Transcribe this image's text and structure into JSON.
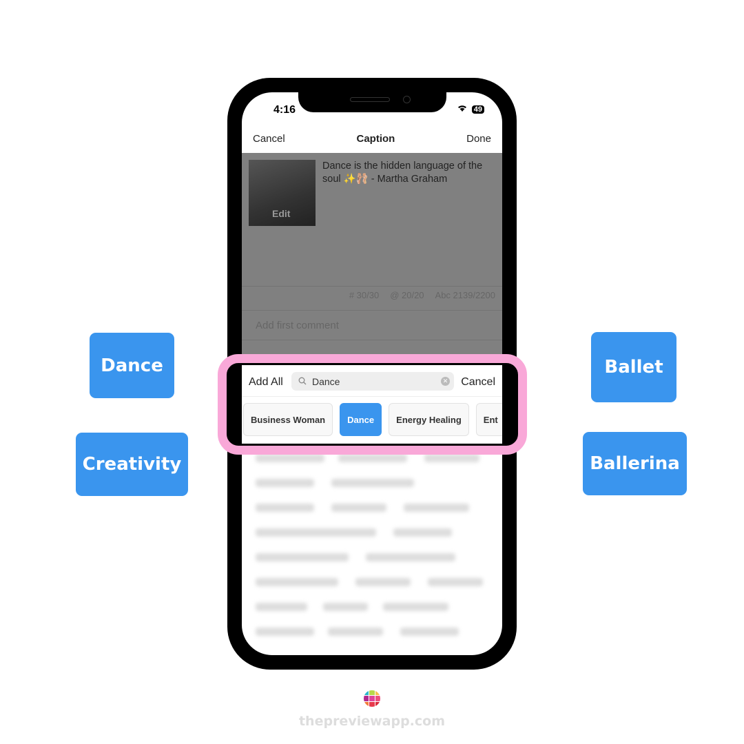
{
  "status": {
    "time": "4:16",
    "battery": "49"
  },
  "nav": {
    "cancel": "Cancel",
    "title": "Caption",
    "done": "Done"
  },
  "post": {
    "edit_label": "Edit",
    "caption": "Dance is the hidden language of the soul ✨🩰 - Martha Graham"
  },
  "counters": {
    "hashtags": "# 30/30",
    "mentions": "@ 20/20",
    "chars": "Abc 2139/2200"
  },
  "comment_placeholder": "Add first comment",
  "hashtag_bar": {
    "add_all": "Add All",
    "search_value": "Dance",
    "cancel": "Cancel",
    "chips": [
      {
        "label": "Business Woman",
        "active": false
      },
      {
        "label": "Dance",
        "active": true
      },
      {
        "label": "Energy Healing",
        "active": false
      },
      {
        "label": "Ent",
        "active": false
      }
    ]
  },
  "side_tags": [
    "Dance",
    "Creativity",
    "Ballet",
    "Ballerina"
  ],
  "footer": {
    "site": "thepreviewapp.com"
  },
  "colors": {
    "accent": "#3a95ee",
    "highlight": "#f9a8d8",
    "overlay": "#808080"
  }
}
